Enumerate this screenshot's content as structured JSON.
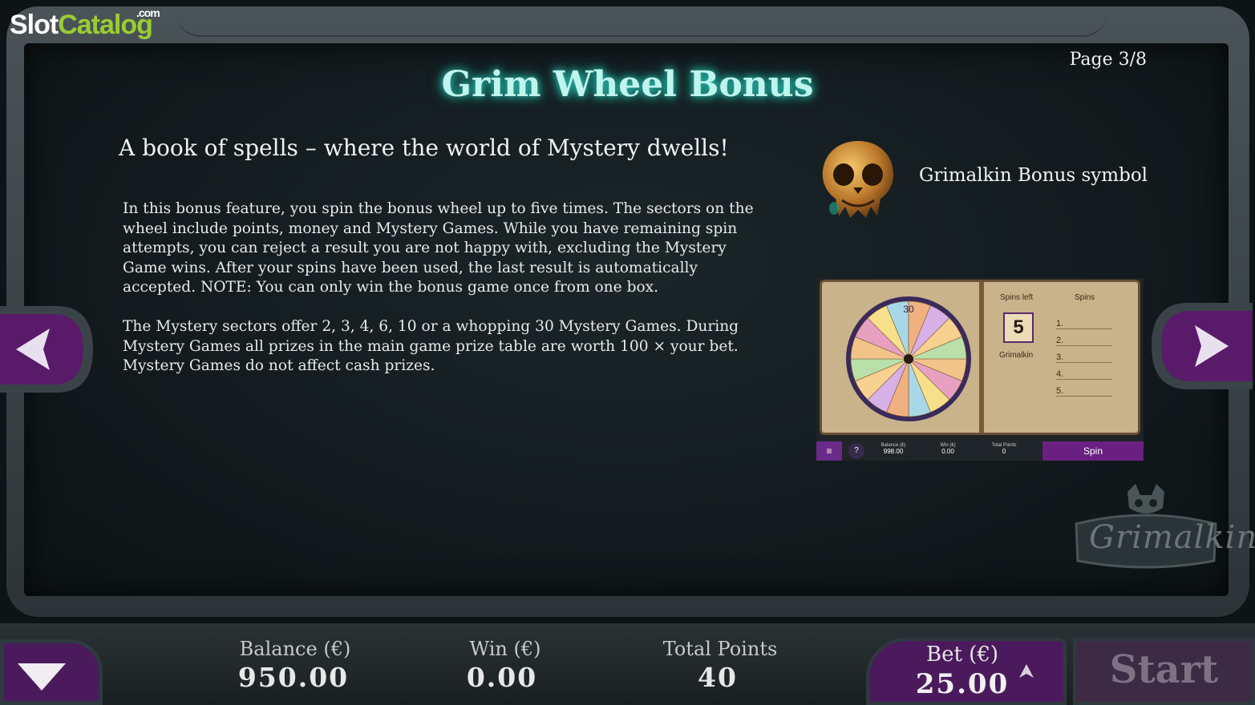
{
  "brand": {
    "slot": "Slot",
    "catalog": "Catalog",
    "com": ".com"
  },
  "page_indicator": "Page 3/8",
  "title": "Grim Wheel Bonus",
  "subtitle": "A book of spells – where the world of Mystery dwells!",
  "paragraphs": [
    "In this bonus feature, you spin the bonus wheel up to five times. The sectors on the wheel include points, money and Mystery Games. While you have remaining spin attempts, you can reject a result you are not happy with, excluding the Mystery Game wins. After your spins have been used, the last result is automatically accepted. NOTE: You can only win the bonus game once from one box.",
    "The Mystery sectors offer 2, 3, 4, 6, 10 or a whopping 30 Mystery Games. During Mystery Games all prizes in the main game prize table are worth 100 × your bet. Mystery Games do not affect cash prizes."
  ],
  "symbol": {
    "icon": "cat-skull-icon",
    "label": "Grimalkin Bonus symbol"
  },
  "book_screenshot": {
    "spins_left_label": "Spins left",
    "spins_header": "Spins",
    "spins_left": "5",
    "character": "Grimalkin",
    "rows": [
      "1.",
      "2.",
      "3.",
      "4.",
      "5."
    ],
    "wheel_top_value": "30",
    "bar": {
      "balance_label": "Balance (€)",
      "balance_value": "998.00",
      "win_label": "Win (€)",
      "win_value": "0.00",
      "points_label": "Total Points",
      "points_value": "0",
      "help": "?",
      "spin_label": "Spin"
    }
  },
  "game_logo": "Grimalkin",
  "bottom": {
    "balance_label": "Balance (€)",
    "balance_value": "950.00",
    "win_label": "Win (€)",
    "win_value": "0.00",
    "points_label": "Total Points",
    "points_value": "40",
    "bet_label": "Bet (€)",
    "bet_value": "25.00",
    "start_label": "Start"
  },
  "colors": {
    "accent_purple": "#4b1a5c",
    "title_glow": "#2fd6c3"
  }
}
